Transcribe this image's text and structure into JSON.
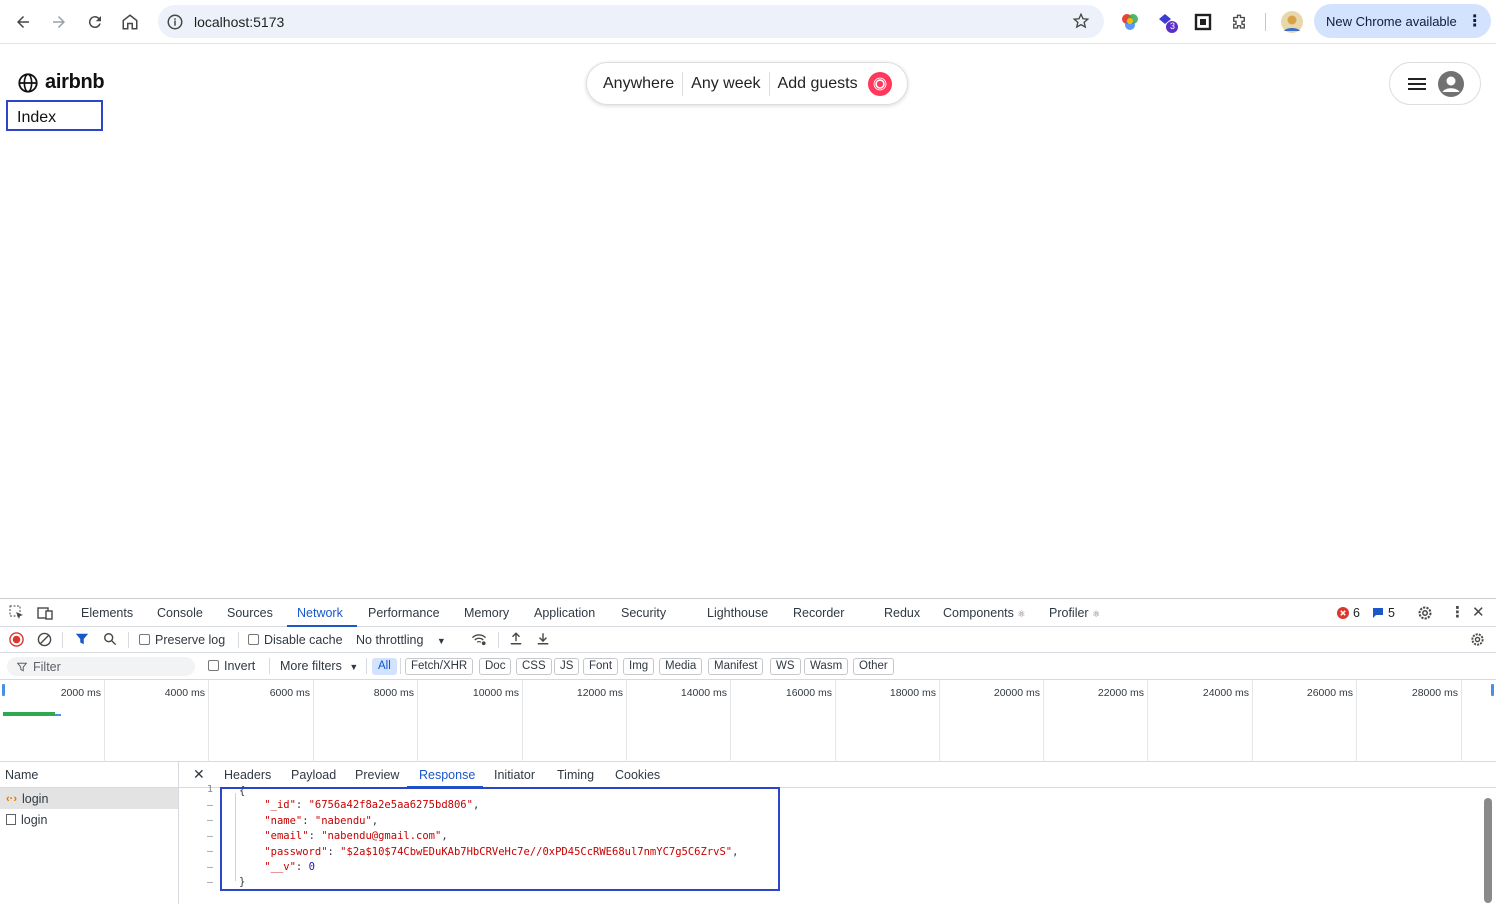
{
  "browser": {
    "url": "localhost:5173",
    "update_label": "New Chrome available",
    "extension_badge": "3"
  },
  "page": {
    "logo_text": "airbnb",
    "index_label": "Index",
    "search": {
      "where": "Anywhere",
      "when": "Any week",
      "who": "Add guests"
    }
  },
  "devtools": {
    "tabs": [
      "Elements",
      "Console",
      "Sources",
      "Network",
      "Performance",
      "Memory",
      "Application",
      "Security",
      "Lighthouse",
      "Recorder",
      "Redux",
      "Components",
      "Profiler"
    ],
    "errors_count": "6",
    "messages_count": "5",
    "toolbar": {
      "preserve_log": "Preserve log",
      "disable_cache": "Disable cache",
      "throttling": "No throttling"
    },
    "filter": {
      "placeholder": "Filter",
      "invert": "Invert",
      "more_filters": "More filters",
      "types": [
        "All",
        "Fetch/XHR",
        "Doc",
        "CSS",
        "JS",
        "Font",
        "Img",
        "Media",
        "Manifest",
        "WS",
        "Wasm",
        "Other"
      ]
    },
    "timeline_ticks": [
      "2000 ms",
      "4000 ms",
      "6000 ms",
      "8000 ms",
      "10000 ms",
      "12000 ms",
      "14000 ms",
      "16000 ms",
      "18000 ms",
      "20000 ms",
      "22000 ms",
      "24000 ms",
      "26000 ms",
      "28000 ms"
    ],
    "requests": {
      "header": "Name",
      "rows": [
        "login",
        "login"
      ]
    },
    "detail_tabs": [
      "Headers",
      "Payload",
      "Preview",
      "Response",
      "Initiator",
      "Timing",
      "Cookies"
    ],
    "response": {
      "gutter": [
        "1",
        "–",
        "–",
        "–",
        "–",
        "–",
        "–"
      ],
      "id_key": "\"_id\"",
      "id_val": "\"6756a42f8a2e5aa6275bd806\"",
      "name_key": "\"name\"",
      "name_val": "\"nabendu\"",
      "email_key": "\"email\"",
      "email_val": "\"nabendu@gmail.com\"",
      "password_key": "\"password\"",
      "password_val": "\"$2a$10$74CbwEDuKAb7HbCRVeHc7e//0xPD45CcRWE68ul7nmYC7g5C6ZrvS\"",
      "v_key": "\"__v\"",
      "v_val": "0"
    }
  }
}
